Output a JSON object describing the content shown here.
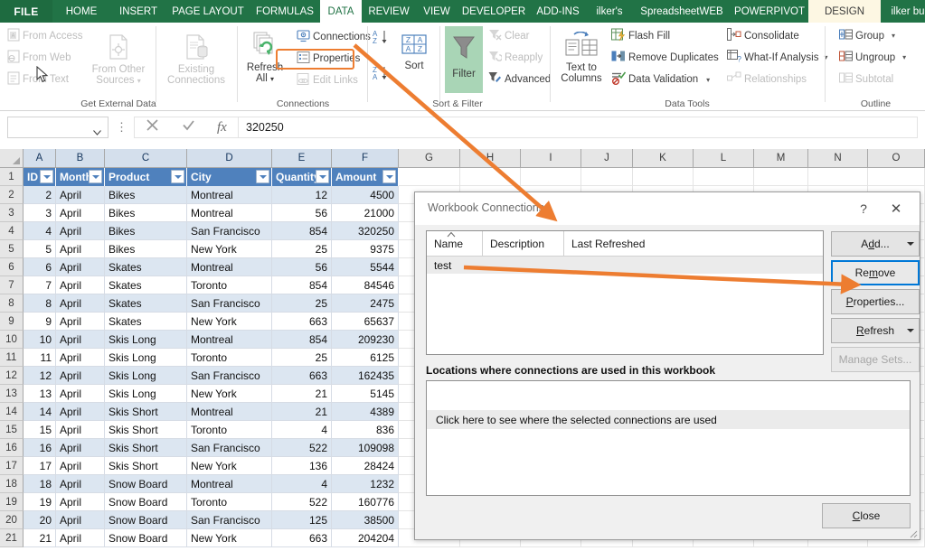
{
  "app": {
    "accent_green": "#217346",
    "highlight_orange": "#ED7D31",
    "focus_blue": "#0078D7"
  },
  "tabs": {
    "file": "FILE",
    "items": [
      {
        "label": "HOME",
        "active": false
      },
      {
        "label": "INSERT",
        "active": false
      },
      {
        "label": "PAGE LAYOUT",
        "active": false
      },
      {
        "label": "FORMULAS",
        "active": false
      },
      {
        "label": "DATA",
        "active": true
      },
      {
        "label": "REVIEW",
        "active": false
      },
      {
        "label": "VIEW",
        "active": false
      },
      {
        "label": "DEVELOPER",
        "active": false
      },
      {
        "label": "ADD-INS",
        "active": false
      },
      {
        "label": "ilker's",
        "active": false
      },
      {
        "label": "SpreadsheetWEB",
        "active": false
      },
      {
        "label": "POWERPIVOT",
        "active": false
      },
      {
        "label": "DESIGN",
        "active": false
      },
      {
        "label": "ilker bu",
        "active": false
      }
    ]
  },
  "ribbon": {
    "groups": [
      {
        "name": "Get External Data"
      },
      {
        "name": "Connections"
      },
      {
        "name": "Sort & Filter"
      },
      {
        "name": "Data Tools"
      },
      {
        "name": "Outline"
      }
    ],
    "get_external_data": {
      "from_access": "From Access",
      "from_web": "From Web",
      "from_text": "From Text",
      "from_other_sources_line1": "From Other",
      "from_other_sources_line2": "Sources",
      "existing_connections_line1": "Existing",
      "existing_connections_line2": "Connections"
    },
    "connections": {
      "refresh_all_line1": "Refresh",
      "refresh_all_line2": "All",
      "connections": "Connections",
      "properties": "Properties",
      "edit_links": "Edit Links"
    },
    "sort_filter": {
      "sort": "Sort",
      "filter": "Filter",
      "clear": "Clear",
      "reapply": "Reapply",
      "advanced": "Advanced"
    },
    "data_tools": {
      "text_to_columns_line1": "Text to",
      "text_to_columns_line2": "Columns",
      "flash_fill": "Flash Fill",
      "remove_duplicates": "Remove Duplicates",
      "data_validation": "Data Validation",
      "consolidate": "Consolidate",
      "what_if_analysis": "What-If Analysis",
      "relationships": "Relationships"
    },
    "outline": {
      "group": "Group",
      "ungroup": "Ungroup",
      "subtotal": "Subtotal"
    }
  },
  "formula_bar": {
    "name_box_value": "",
    "name_box_placeholder": "",
    "cancel_icon": "cancel-icon",
    "enter_icon": "enter-icon",
    "function_icon": "fx",
    "value": "320250"
  },
  "sheet": {
    "column_headers": [
      "A",
      "B",
      "C",
      "D",
      "E",
      "F",
      "G",
      "H",
      "I",
      "J",
      "K",
      "L",
      "M",
      "N",
      "O"
    ],
    "selected_columns": [
      "A",
      "B",
      "C",
      "D",
      "E",
      "F"
    ],
    "row_numbers": [
      1,
      2,
      3,
      4,
      5,
      6,
      7,
      8,
      9,
      10,
      11,
      12,
      13,
      14,
      15,
      16,
      17,
      18,
      19,
      20,
      21
    ],
    "table_headers": [
      "ID",
      "Month",
      "Product",
      "City",
      "Quantity",
      "Amount"
    ],
    "rows": [
      {
        "id": "2",
        "month": "April",
        "product": "Bikes",
        "city": "Montreal",
        "quantity": "12",
        "amount": "4500"
      },
      {
        "id": "3",
        "month": "April",
        "product": "Bikes",
        "city": "Montreal",
        "quantity": "56",
        "amount": "21000"
      },
      {
        "id": "4",
        "month": "April",
        "product": "Bikes",
        "city": "San Francisco",
        "quantity": "854",
        "amount": "320250"
      },
      {
        "id": "5",
        "month": "April",
        "product": "Bikes",
        "city": "New York",
        "quantity": "25",
        "amount": "9375"
      },
      {
        "id": "6",
        "month": "April",
        "product": "Skates",
        "city": "Montreal",
        "quantity": "56",
        "amount": "5544"
      },
      {
        "id": "7",
        "month": "April",
        "product": "Skates",
        "city": "Toronto",
        "quantity": "854",
        "amount": "84546"
      },
      {
        "id": "8",
        "month": "April",
        "product": "Skates",
        "city": "San Francisco",
        "quantity": "25",
        "amount": "2475"
      },
      {
        "id": "9",
        "month": "April",
        "product": "Skates",
        "city": "New York",
        "quantity": "663",
        "amount": "65637"
      },
      {
        "id": "10",
        "month": "April",
        "product": "Skis Long",
        "city": "Montreal",
        "quantity": "854",
        "amount": "209230"
      },
      {
        "id": "11",
        "month": "April",
        "product": "Skis Long",
        "city": "Toronto",
        "quantity": "25",
        "amount": "6125"
      },
      {
        "id": "12",
        "month": "April",
        "product": "Skis Long",
        "city": "San Francisco",
        "quantity": "663",
        "amount": "162435"
      },
      {
        "id": "13",
        "month": "April",
        "product": "Skis Long",
        "city": "New York",
        "quantity": "21",
        "amount": "5145"
      },
      {
        "id": "14",
        "month": "April",
        "product": "Skis Short",
        "city": "Montreal",
        "quantity": "21",
        "amount": "4389"
      },
      {
        "id": "15",
        "month": "April",
        "product": "Skis Short",
        "city": "Toronto",
        "quantity": "4",
        "amount": "836"
      },
      {
        "id": "16",
        "month": "April",
        "product": "Skis Short",
        "city": "San Francisco",
        "quantity": "522",
        "amount": "109098"
      },
      {
        "id": "17",
        "month": "April",
        "product": "Skis Short",
        "city": "New York",
        "quantity": "136",
        "amount": "28424"
      },
      {
        "id": "18",
        "month": "April",
        "product": "Snow Board",
        "city": "Montreal",
        "quantity": "4",
        "amount": "1232"
      },
      {
        "id": "19",
        "month": "April",
        "product": "Snow Board",
        "city": "Toronto",
        "quantity": "522",
        "amount": "160776"
      },
      {
        "id": "20",
        "month": "April",
        "product": "Snow Board",
        "city": "San Francisco",
        "quantity": "125",
        "amount": "38500"
      },
      {
        "id": "21",
        "month": "April",
        "product": "Snow Board",
        "city": "New York",
        "quantity": "663",
        "amount": "204204"
      }
    ]
  },
  "dialog": {
    "title": "Workbook Connections",
    "help_glyph": "?",
    "close_glyph": "✕",
    "list_columns": [
      "Name",
      "Description",
      "Last Refreshed"
    ],
    "connections": [
      {
        "name": "test",
        "description": "",
        "last_refreshed": ""
      }
    ],
    "buttons": {
      "add": "Add...",
      "remove": "Remove",
      "properties": "Properties...",
      "refresh": "Refresh",
      "manage_sets": "Manage Sets...",
      "close": "Close"
    },
    "locations_label": "Locations where connections are used in this workbook",
    "locations_hint": "Click here to see where the selected connections are used"
  }
}
